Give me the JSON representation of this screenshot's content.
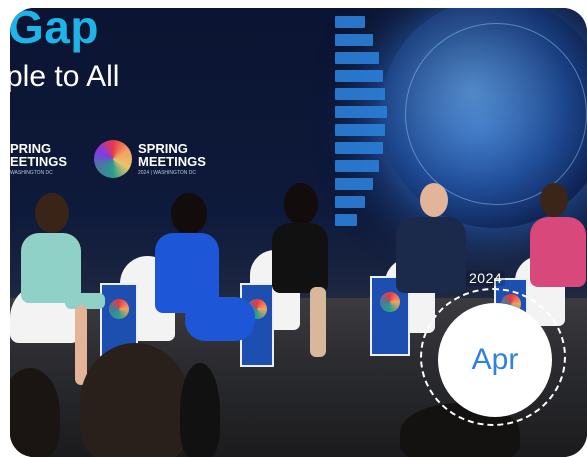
{
  "hero": {
    "headline_fragment": "Gap",
    "subline_fragment": "ple to All"
  },
  "logos": {
    "left": {
      "line1": "PRING",
      "line2": "EETINGS",
      "sub": "WASHINGTON DC"
    },
    "right": {
      "line1": "SPRING",
      "line2": "MEETINGS",
      "sub": "2024 | WASHINGTON DC"
    }
  },
  "date_badge": {
    "year": "2024",
    "month": "Apr"
  },
  "colors": {
    "headline": "#1fb4e8",
    "month_text": "#2f7fe5",
    "table_blue": "#1c4fb0",
    "badge_bg": "#ffffff"
  }
}
